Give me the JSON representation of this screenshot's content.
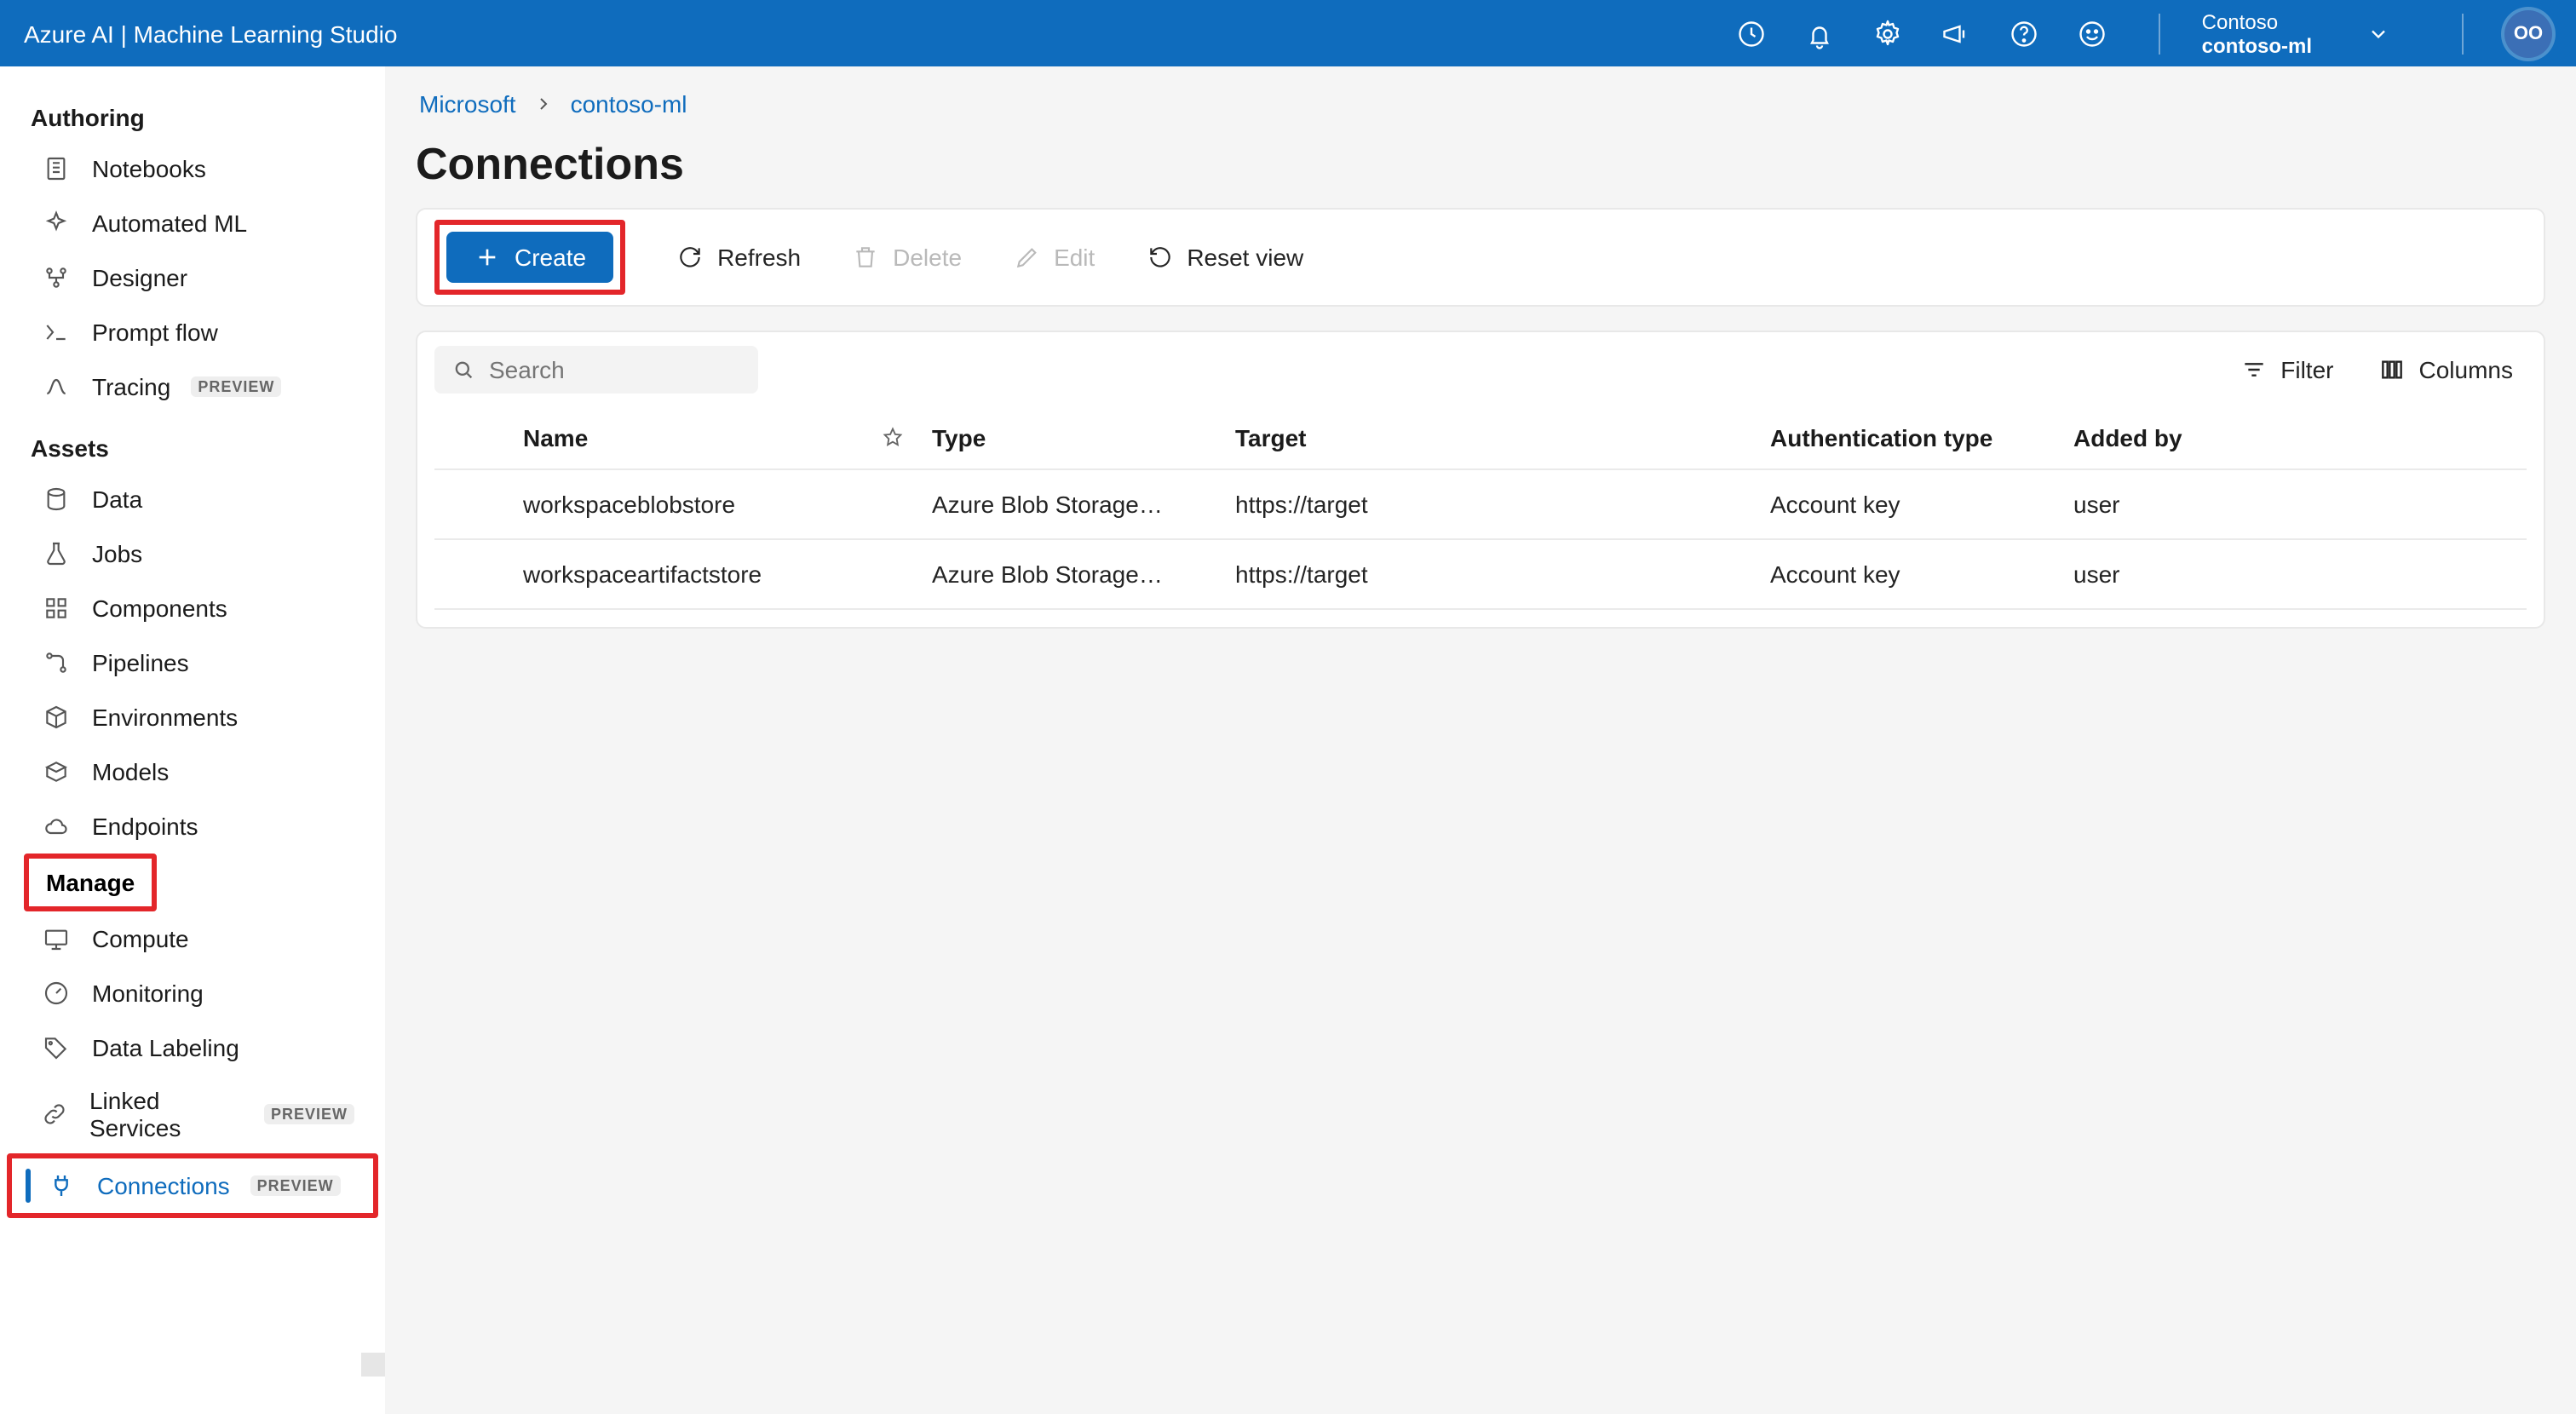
{
  "header": {
    "title": "Azure AI | Machine Learning Studio",
    "tenant_org": "Contoso",
    "tenant_workspace": "contoso-ml",
    "avatar_initials": "OO"
  },
  "sidebar": {
    "sections": {
      "authoring": "Authoring",
      "assets": "Assets",
      "manage": "Manage"
    },
    "preview_badge": "PREVIEW",
    "items": {
      "notebooks": "Notebooks",
      "automl": "Automated ML",
      "designer": "Designer",
      "promptflow": "Prompt flow",
      "tracing": "Tracing",
      "data": "Data",
      "jobs": "Jobs",
      "components": "Components",
      "pipelines": "Pipelines",
      "environments": "Environments",
      "models": "Models",
      "endpoints": "Endpoints",
      "compute": "Compute",
      "monitoring": "Monitoring",
      "datalabeling": "Data Labeling",
      "linkedservices": "Linked Services",
      "connections": "Connections"
    }
  },
  "breadcrumb": {
    "root": "Microsoft",
    "ws": "contoso-ml"
  },
  "page": {
    "title": "Connections",
    "toolbar": {
      "create": "Create",
      "refresh": "Refresh",
      "delete": "Delete",
      "edit": "Edit",
      "reset": "Reset view"
    }
  },
  "panel": {
    "search_placeholder": "Search",
    "filter": "Filter",
    "columns": "Columns"
  },
  "table": {
    "headers": {
      "name": "Name",
      "type": "Type",
      "target": "Target",
      "auth": "Authentication type",
      "added": "Added by"
    },
    "rows": [
      {
        "name": "workspaceblobstore",
        "type": "Azure Blob Storage…",
        "target": "https://target",
        "auth": "Account key",
        "added": "user"
      },
      {
        "name": "workspaceartifactstore",
        "type": "Azure Blob Storage…",
        "target": "https://target",
        "auth": "Account key",
        "added": "user"
      }
    ]
  }
}
